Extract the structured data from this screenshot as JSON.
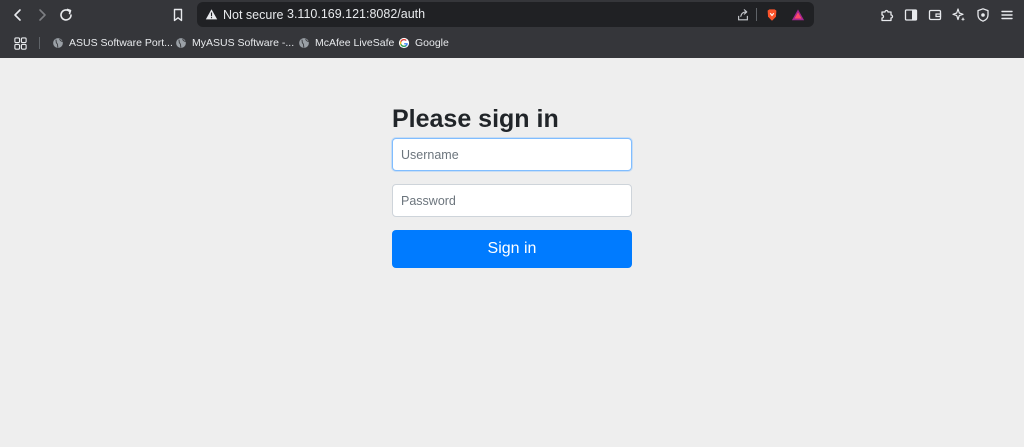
{
  "browser": {
    "security_label": "Not secure",
    "url": "3.110.169.121:8082/auth",
    "icons": {
      "back": "arrow-left-icon",
      "forward": "arrow-right-icon",
      "reload": "reload-icon",
      "bookmark": "bookmark-icon",
      "warning": "warning-triangle-icon",
      "share": "share-icon",
      "brave": "brave-shield-icon",
      "rewards": "brave-rewards-icon",
      "extensions": "puzzle-icon",
      "sidebar": "sidebar-icon",
      "wallet": "wallet-icon",
      "leo": "sparkle-icon",
      "vpn": "vpn-shield-icon"
    },
    "colors": {
      "chrome": "#35363a",
      "omnibox": "#202124",
      "text": "#e8eaed"
    }
  },
  "bookmarks_bar": {
    "items": [
      {
        "label": "ASUS Software Port...",
        "icon": "globe-icon"
      },
      {
        "label": "MyASUS Software -...",
        "icon": "globe-icon"
      },
      {
        "label": "McAfee LiveSafe",
        "icon": "globe-icon"
      },
      {
        "label": "Google",
        "icon": "google-icon"
      }
    ]
  },
  "signin": {
    "heading": "Please sign in",
    "username_placeholder": "Username",
    "username_value": "",
    "password_placeholder": "Password",
    "password_value": "",
    "submit_label": "Sign in",
    "colors": {
      "background": "#eeeeee",
      "primary": "#007bff",
      "heading": "#212529"
    }
  }
}
